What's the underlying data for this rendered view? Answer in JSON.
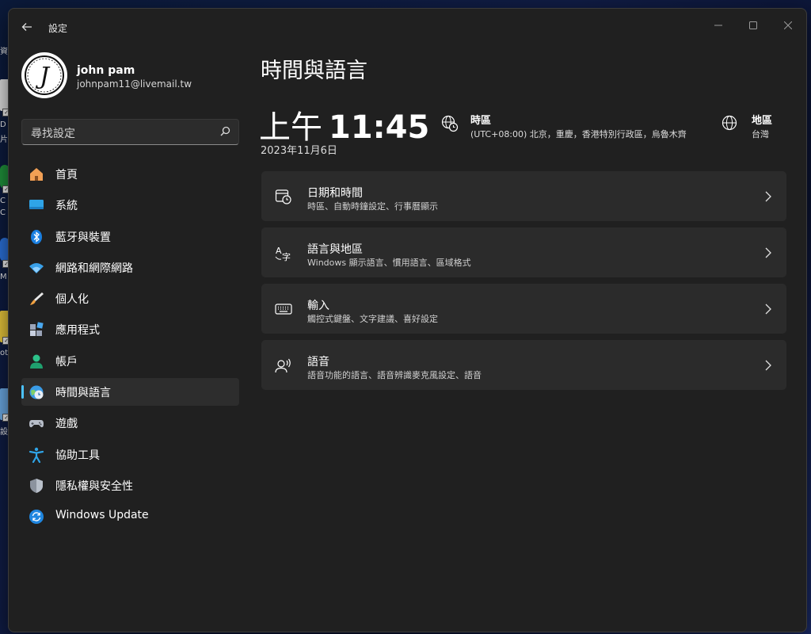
{
  "desktop": {
    "fragments": [
      "資",
      "D",
      "片",
      "C",
      "C",
      "M",
      "ot",
      "設"
    ]
  },
  "window": {
    "app_title": "設定",
    "controls": [
      "minimize-icon",
      "maximize-icon",
      "close-icon"
    ]
  },
  "account": {
    "avatar_letter": "J",
    "name": "john pam",
    "email": "johnpam11@livemail.tw"
  },
  "search": {
    "placeholder": "尋找設定",
    "icon": "search-icon"
  },
  "sidebar": {
    "items": [
      {
        "label": "首頁",
        "icon": "home-icon"
      },
      {
        "label": "系統",
        "icon": "system-icon"
      },
      {
        "label": "藍牙與裝置",
        "icon": "bluetooth-icon"
      },
      {
        "label": "網路和網際網路",
        "icon": "wifi-icon"
      },
      {
        "label": "個人化",
        "icon": "brush-icon"
      },
      {
        "label": "應用程式",
        "icon": "apps-icon"
      },
      {
        "label": "帳戶",
        "icon": "account-icon"
      },
      {
        "label": "時間與語言",
        "icon": "time-language-icon",
        "active": true
      },
      {
        "label": "遊戲",
        "icon": "gamepad-icon"
      },
      {
        "label": "協助工具",
        "icon": "accessibility-icon"
      },
      {
        "label": "隱私權與安全性",
        "icon": "shield-icon"
      },
      {
        "label": "Windows Update",
        "icon": "update-icon"
      }
    ],
    "accent_color": "#4cc2ff"
  },
  "main": {
    "title": "時間與語言",
    "clock": {
      "ampm": "上午",
      "time": "11:45",
      "date": "2023年11月6日"
    },
    "timezone": {
      "label": "時區",
      "value": "(UTC+08:00) 北京，重慶，香港特別行政區，烏魯木齊",
      "icon": "timezone-globe-icon"
    },
    "region": {
      "label": "地區",
      "value": "台灣",
      "icon": "globe-icon"
    },
    "cards": [
      {
        "title": "日期和時間",
        "subtitle": "時區、自動時鐘設定、行事曆顯示",
        "icon": "calendar-clock-icon"
      },
      {
        "title": "語言與地區",
        "subtitle": "Windows 顯示語言、慣用語言、區域格式",
        "icon": "language-icon"
      },
      {
        "title": "輸入",
        "subtitle": "觸控式鍵盤、文字建議、喜好設定",
        "icon": "keyboard-icon"
      },
      {
        "title": "語音",
        "subtitle": "語音功能的語言、語音辨識麥克風設定、語音",
        "icon": "speech-icon"
      }
    ]
  }
}
